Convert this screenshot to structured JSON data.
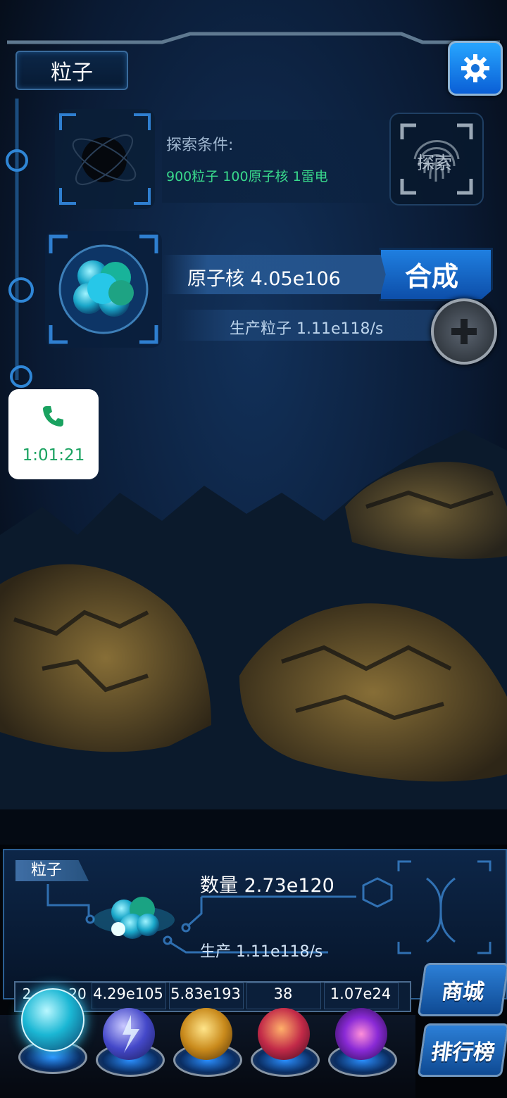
{
  "header": {
    "title": "粒子"
  },
  "explore": {
    "condition_label": "探索条件:",
    "requirements": "900粒子 100原子核 1雷电",
    "button_label": "探索"
  },
  "nucleus": {
    "count_text": "原子核 4.05e106",
    "synthesize_label": "合成",
    "production_text": "生产粒子 1.11e118/s"
  },
  "call_widget": {
    "time": "1:01:21",
    "icon": "phone-icon"
  },
  "panel": {
    "tag": "粒子",
    "quantity_text": "数量 2.73e120",
    "production_text": "生产 1.11e118/s"
  },
  "resources": [
    "2.73e120",
    "4.29e105",
    "5.83e193",
    "38",
    "1.07e24"
  ],
  "resource_visible": [
    "2",
    "20"
  ],
  "side_buttons": {
    "shop": "商城",
    "ranking": "排行榜"
  },
  "colors": {
    "accent_blue": "#1f7fe0",
    "requirement_green": "#39d98c",
    "call_green": "#1aa260"
  }
}
